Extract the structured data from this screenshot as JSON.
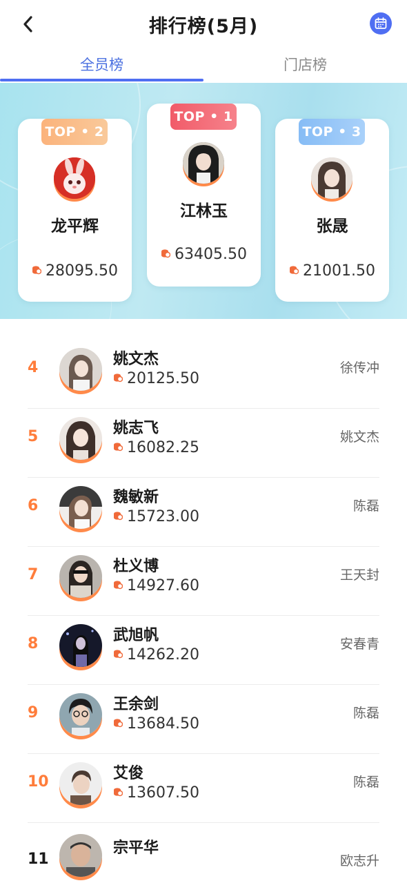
{
  "header": {
    "title": "排行榜(5月)",
    "back_icon": "chevron-left-icon",
    "calendar_icon": "calendar-icon",
    "accent": "#4f6ef2"
  },
  "tabs": [
    {
      "label": "全员榜",
      "active": true
    },
    {
      "label": "门店榜",
      "active": false
    }
  ],
  "podium": [
    {
      "badge": "TOP • 2",
      "name": "龙平辉",
      "amount": "28095.50",
      "badge_color": "#f9b07a"
    },
    {
      "badge": "TOP • 1",
      "name": "江林玉",
      "amount": "63405.50",
      "badge_color": "#f3636f"
    },
    {
      "badge": "TOP • 3",
      "name": "张晟",
      "amount": "21001.50",
      "badge_color": "#8cc0f6"
    }
  ],
  "list": [
    {
      "rank": "4",
      "name": "姚文杰",
      "amount": "20125.50",
      "store": "徐传冲"
    },
    {
      "rank": "5",
      "name": "姚志飞",
      "amount": "16082.25",
      "store": "姚文杰"
    },
    {
      "rank": "6",
      "name": "魏敏新",
      "amount": "15723.00",
      "store": "陈磊"
    },
    {
      "rank": "7",
      "name": "杜义博",
      "amount": "14927.60",
      "store": "王天封"
    },
    {
      "rank": "8",
      "name": "武旭帆",
      "amount": "14262.20",
      "store": "安春青"
    },
    {
      "rank": "9",
      "name": "王余剑",
      "amount": "13684.50",
      "store": "陈磊"
    },
    {
      "rank": "10",
      "name": "艾俊",
      "amount": "13607.50",
      "store": "陈磊"
    },
    {
      "rank": "11",
      "name": "宗平华",
      "amount": "",
      "store": "欧志升"
    }
  ],
  "colors": {
    "rank": "#ff7d3b",
    "coin": "#f06a3a",
    "avatar_ring": "#ff8a4a"
  }
}
